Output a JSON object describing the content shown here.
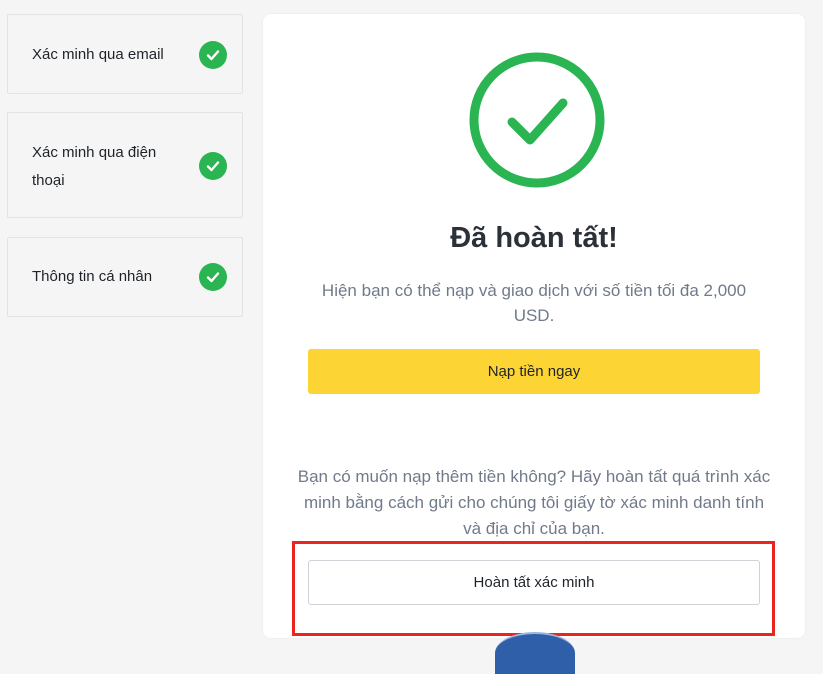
{
  "steps": [
    {
      "label": "Xác minh qua email",
      "status": "completed",
      "icon": "check-icon"
    },
    {
      "label": "Xác minh qua điện thoại",
      "status": "completed",
      "icon": "check-icon"
    },
    {
      "label": "Thông tin cá nhân",
      "status": "completed",
      "icon": "check-icon"
    }
  ],
  "result": {
    "icon": "success-check-circle-icon",
    "title": "Đã hoàn tất!",
    "description": "Hiện bạn có thể nạp và giao dịch với số tiền tối đa 2,000 USD.",
    "deposit_button": "Nạp tiền ngay",
    "more_info": "Bạn có muốn nạp thêm tiền không? Hãy hoàn tất quá trình xác minh bằng cách gửi cho chúng tôi giấy tờ xác minh danh tính và địa chỉ của bạn.",
    "complete_button": "Hoàn tất xác minh"
  },
  "colors": {
    "success": "#2ab452",
    "primary": "#fcd535",
    "highlight_box": "#e8261d",
    "marker": "#fff200"
  }
}
